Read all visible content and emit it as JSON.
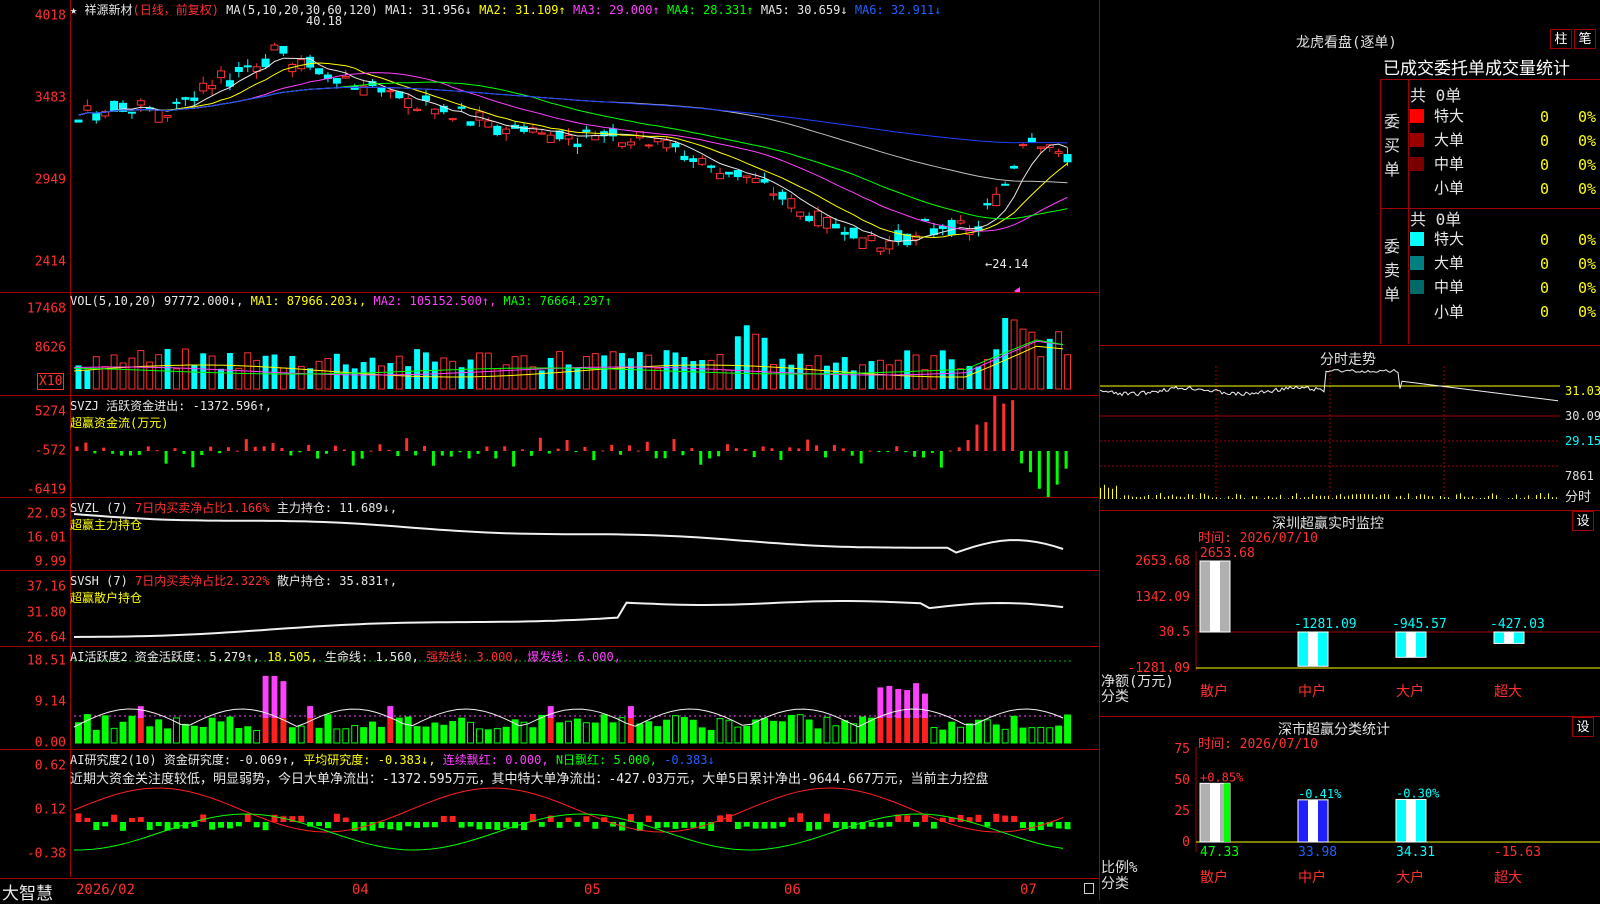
{
  "main": {
    "header": {
      "star": "★",
      "stock_name": "祥源新材",
      "period": "(日线，前复权)",
      "ma_params": "MA(5,10,20,30,60,120)",
      "ma1": "MA1: 31.956↓",
      "ma2": "MA2: 31.109↑",
      "ma3": "MA3: 29.000↑",
      "ma4": "MA4: 28.331↑",
      "ma5": "MA5: 30.659↓",
      "ma6": "MA6: 32.911↓"
    },
    "y_ticks": [
      "4018",
      "3483",
      "2949",
      "2414"
    ],
    "high_label": "40.18",
    "low_label": "←24.14"
  },
  "vol": {
    "header": {
      "name": "VOL(5,10,20)",
      "v": "97772.000↓,",
      "ma1": "MA1: 87966.203↓,",
      "ma2": "MA2: 105152.500↑,",
      "ma3": "MA3: 76664.297↑"
    },
    "y_ticks": [
      "17468",
      "8626"
    ],
    "unit": "X10"
  },
  "svzj": {
    "header": {
      "name": "SVZJ",
      "text": "活跃资金进出: -1372.596↑,",
      "sub": "超赢资金流(万元)"
    },
    "y_ticks": [
      "5274",
      "-572",
      "-6419"
    ]
  },
  "svzl": {
    "header": {
      "name": "SVZL (7)",
      "text1": "7日内买卖净占比1.166%",
      "text2": "主力持仓: 11.689↓,",
      "sub": "超赢主力持仓"
    },
    "y_ticks": [
      "22.03",
      "16.01",
      "9.99"
    ]
  },
  "svsh": {
    "header": {
      "name": "SVSH (7)",
      "text1": "7日内买卖净占比2.322%",
      "text2": "散户持仓: 35.831↑,",
      "sub": "超赢散户持仓"
    },
    "y_ticks": [
      "37.16",
      "31.80",
      "26.64"
    ]
  },
  "ai1": {
    "header": {
      "name": "AI活跃度2",
      "t1": "资金活跃度: 5.279↑,",
      "t2": "18.505,",
      "t3": "生命线: 1.560,",
      "t4": "强势线: 3.000,",
      "t5": "爆发线: 6.000,"
    },
    "y_ticks": [
      "18.51",
      "9.14",
      "0.00"
    ]
  },
  "ai2": {
    "header": {
      "name": "AI研究度2(10)",
      "t1": "资金研究度: -0.069↑,",
      "t2": "平均研究度: -0.383↓,",
      "t3": "连续飘红: 0.000,",
      "t4": "N日飘红: 5.000,",
      "t5": "-0.383↓"
    },
    "comment": "近期大资金关注度较低，明显弱势，今日大单净流出：-1372.595万元，其中特大单净流出：-427.03万元，大单5日累计净出-9644.667万元，当前主力控盘",
    "y_ticks": [
      "0.62",
      "0.12",
      "-0.38"
    ]
  },
  "bottom": {
    "logo": "大智慧",
    "dates": [
      "2026/02",
      "04",
      "05",
      "06",
      "07"
    ]
  },
  "right": {
    "lhb": {
      "title": "龙虎看盘(逐单)",
      "btn1": "柱",
      "btn2": "笔",
      "subtitle": "已成交委托单成交量统计",
      "buy_total": "共 0单",
      "buy_label": "委买单",
      "sell_total": "共 0单",
      "sell_label": "委卖单",
      "rows": [
        {
          "label": "特大",
          "val": "0",
          "pct": "0%"
        },
        {
          "label": "大单",
          "val": "0",
          "pct": "0%"
        },
        {
          "label": "中单",
          "val": "0",
          "pct": "0%"
        },
        {
          "label": "小单",
          "val": "0",
          "pct": "0%"
        }
      ],
      "buy_colors": [
        "#ff0000",
        "#990000",
        "#7a0000",
        "#000000"
      ],
      "sell_colors": [
        "#00ffff",
        "#008080",
        "#006a6a",
        "#000000"
      ]
    },
    "fenshi": {
      "title": "分时走势",
      "ticks": [
        "31.03",
        "30.09",
        "29.15"
      ],
      "vol_tick": "7861",
      "vol_label": "分时"
    },
    "szmon": {
      "title": "深圳超赢实时监控",
      "btn": "设",
      "time": "时间: 2026/07/10",
      "y_ticks": [
        "2653.68",
        "1342.09",
        "30.5",
        "-1281.09"
      ],
      "ylabel": "净额(万元)",
      "xlabel": "分类",
      "categories": [
        "散户",
        "中户",
        "大户",
        "超大"
      ],
      "values": [
        2653.68,
        -1281.09,
        -945.57,
        -427.03
      ],
      "value_labels": [
        "2653.68",
        "-1281.09",
        "-945.57",
        "-427.03"
      ]
    },
    "szcls": {
      "title": "深市超赢分类统计",
      "btn": "设",
      "time": "时间: 2026/07/10",
      "y_ticks": [
        "75",
        "50",
        "25",
        "0"
      ],
      "ylabel": "比例%",
      "xlabel": "分类",
      "categories": [
        "散户",
        "中户",
        "大户",
        "超大"
      ],
      "values": [
        47.33,
        33.98,
        34.31,
        -15.63
      ],
      "value_labels": [
        "47.33",
        "33.98",
        "34.31",
        "-15.63"
      ],
      "changes": [
        "+0.85%",
        "-0.41%",
        "-0.30%",
        ""
      ]
    }
  },
  "colors": {
    "up": "#ff3030",
    "down": "#00ffff",
    "grid": "#a00000"
  }
}
